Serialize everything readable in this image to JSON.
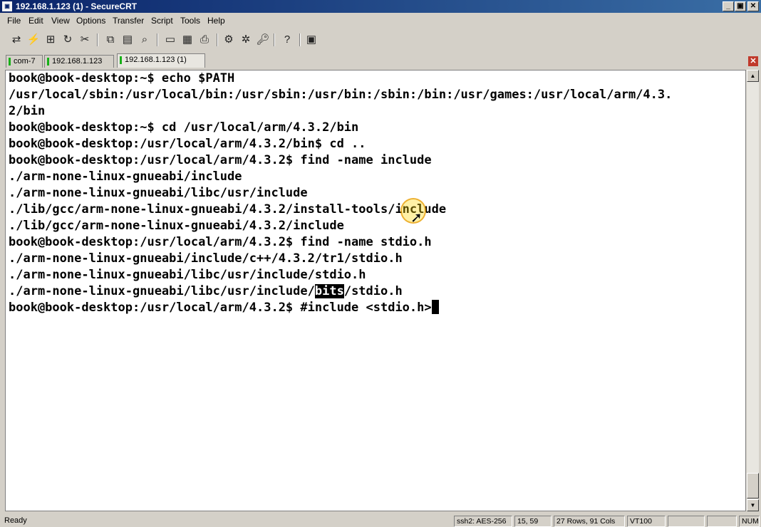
{
  "window": {
    "title": "192.168.1.123 (1) - SecureCRT",
    "app_icon": "securecrt-app-icon",
    "minimize_glyph": "_",
    "maximize_glyph": "▣",
    "close_glyph": "✕"
  },
  "menu": [
    "File",
    "Edit",
    "View",
    "Options",
    "Transfer",
    "Script",
    "Tools",
    "Help"
  ],
  "toolbar": {
    "icons": [
      "connect-icon",
      "quick-connect-icon",
      "connect-tab-icon",
      "reconnect-icon",
      "disconnect-icon",
      "copy-icon",
      "paste-icon",
      "find-icon",
      "print-setup-icon",
      "print-selection-icon",
      "print-icon",
      "session-options-icon",
      "global-options-icon",
      "keymap-icon",
      "help-icon",
      "sftp-icon"
    ]
  },
  "tabs": [
    {
      "label": "com-7",
      "active": false
    },
    {
      "label": "192.168.1.123",
      "active": false
    },
    {
      "label": "192.168.1.123 (1)",
      "active": true
    }
  ],
  "tab_close_glyph": "✕",
  "terminal": {
    "lines": [
      "book@book-desktop:~$ echo $PATH",
      "/usr/local/sbin:/usr/local/bin:/usr/sbin:/usr/bin:/sbin:/bin:/usr/games:/usr/local/arm/4.3.",
      "2/bin",
      "book@book-desktop:~$ cd /usr/local/arm/4.3.2/bin",
      "book@book-desktop:/usr/local/arm/4.3.2/bin$ cd ..",
      "book@book-desktop:/usr/local/arm/4.3.2$ find -name include",
      "./arm-none-linux-gnueabi/include",
      "./arm-none-linux-gnueabi/libc/usr/include",
      "./lib/gcc/arm-none-linux-gnueabi/4.3.2/install-tools/include",
      "./lib/gcc/arm-none-linux-gnueabi/4.3.2/include",
      "book@book-desktop:/usr/local/arm/4.3.2$ find -name stdio.h",
      "./arm-none-linux-gnueabi/include/c++/4.3.2/tr1/stdio.h",
      "./arm-none-linux-gnueabi/libc/usr/include/stdio.h"
    ],
    "highlight_line": {
      "before": "./arm-none-linux-gnueabi/libc/usr/include/",
      "selected": "bits",
      "after": "/stdio.h"
    },
    "prompt_line": "book@book-desktop:/usr/local/arm/4.3.2$ #include <stdio.h>"
  },
  "scrollbar": {
    "up_glyph": "▲",
    "down_glyph": "▼"
  },
  "pointer_glyph": "➚",
  "status": {
    "text": "Ready",
    "panes": [
      "ssh2: AES-256",
      "15, 59",
      "27 Rows, 91 Cols",
      "VT100",
      "",
      "",
      "NUM"
    ]
  }
}
